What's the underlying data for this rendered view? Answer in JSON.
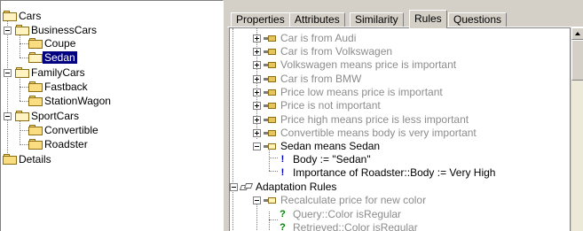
{
  "tree": {
    "nodes": [
      {
        "label": "Cars",
        "selected": false
      },
      {
        "label": "BusinessCars",
        "selected": false
      },
      {
        "label": "Coupe",
        "selected": false
      },
      {
        "label": "Sedan",
        "selected": true
      },
      {
        "label": "FamilyCars",
        "selected": false
      },
      {
        "label": "Fastback",
        "selected": false
      },
      {
        "label": "StationWagon",
        "selected": false
      },
      {
        "label": "SportCars",
        "selected": false
      },
      {
        "label": "Convertible",
        "selected": false
      },
      {
        "label": "Roadster",
        "selected": false
      },
      {
        "label": "Details",
        "selected": false
      }
    ]
  },
  "tabs": [
    {
      "label": "Properties",
      "active": false
    },
    {
      "label": "Attributes",
      "active": false
    },
    {
      "label": "Similarity",
      "active": false
    },
    {
      "label": "Rules",
      "active": true
    },
    {
      "label": "Questions",
      "active": false
    }
  ],
  "rules": [
    {
      "label": "Car is from Audi"
    },
    {
      "label": "Car is from Volkswagen"
    },
    {
      "label": "Volkswagen means price is important"
    },
    {
      "label": "Car is from BMW"
    },
    {
      "label": "Price low means price is important"
    },
    {
      "label": "Price is not important"
    },
    {
      "label": "Price high means price is less important"
    },
    {
      "label": "Convertible means body is very important"
    },
    {
      "label": "Sedan means Sedan"
    },
    {
      "label": "Body := \"Sedan\""
    },
    {
      "label": "Importance of Roadster::Body := Very High"
    },
    {
      "label": "Adaptation Rules"
    },
    {
      "label": "Recalculate price for new color"
    },
    {
      "label": "Query::Color isRegular"
    },
    {
      "label": "Retrieved::Color isRegular"
    }
  ],
  "colors": {
    "selection_bg": "#000080",
    "inactive_rule_text": "#8c8c8c",
    "folder_fill": "#f9dd80",
    "assign_icon": "#0000c0",
    "query_icon": "#008000"
  }
}
